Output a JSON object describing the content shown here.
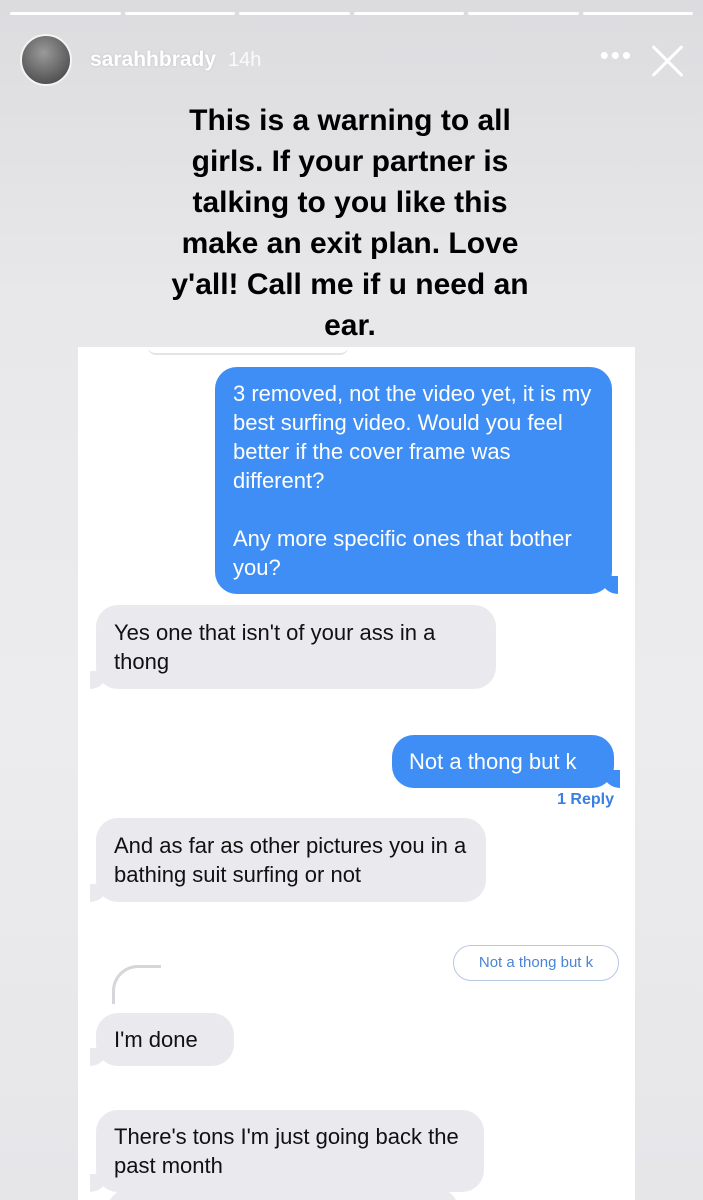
{
  "story": {
    "username": "sarahhbrady",
    "time_ago": "14h",
    "more_label": "•••",
    "segments_total": 6,
    "segments_done": 6,
    "caption": "This is a warning to all girls. If your partner is talking to you like this make an exit plan. Love y'all! Call me if u need an ear."
  },
  "conversation": {
    "sent_1_para1": "3 removed, not the video yet, it is my best surfing video. Would you feel better if the cover frame was different?",
    "sent_1_para2": "Any more specific ones that bother you?",
    "received_1": "Yes one that isn't of your ass in a thong",
    "sent_2": "Not a thong but k",
    "reply_count": "1 Reply",
    "received_2": "And as far as other pictures you in a bathing suit surfing or not",
    "quoted_reply": "Not a thong but k",
    "received_3": "I'm done",
    "received_4": "There's tons I'm just going back the past month"
  },
  "colors": {
    "sent_bubble": "#3f8ef5",
    "received_bubble": "#e9e9ee",
    "link": "#3a7fe0"
  },
  "icons": [
    "avatar",
    "more-icon",
    "close-icon",
    "reply-thread-icon"
  ]
}
